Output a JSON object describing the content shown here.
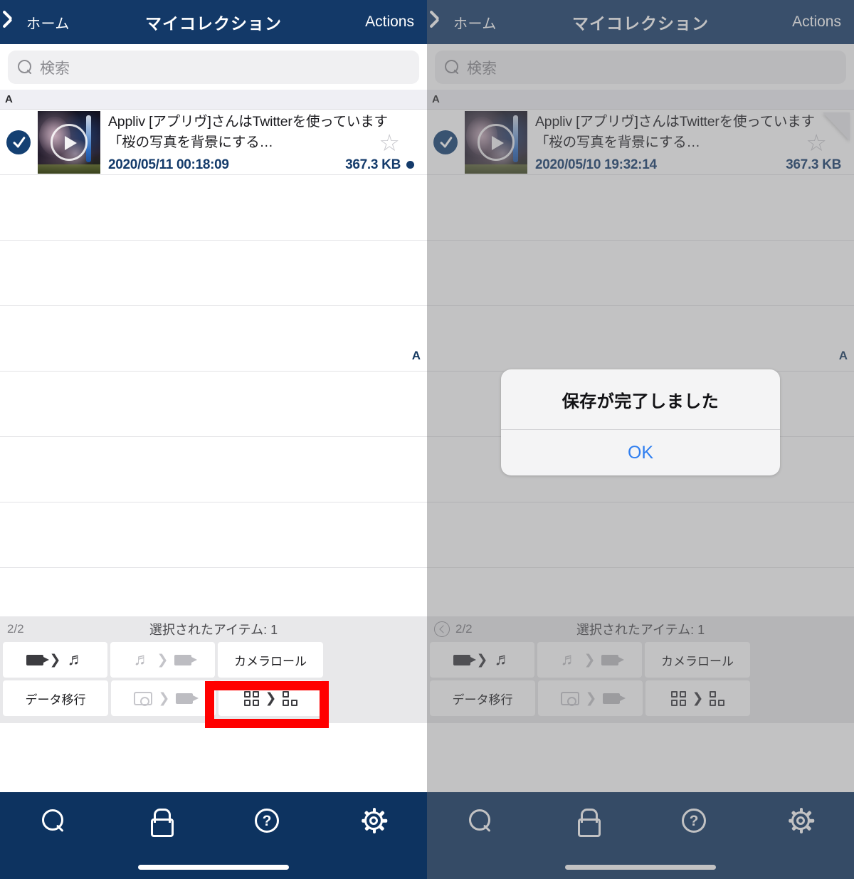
{
  "colors": {
    "navy": "#133968",
    "tabbar_navy": "#0d3360",
    "accent_blue": "#2f7ef0",
    "highlight_red": "#ff0000",
    "toolbar_gray": "#e8e8ea"
  },
  "nav": {
    "back_label": "ホーム",
    "title": "マイコレクション",
    "actions_label": "Actions"
  },
  "search": {
    "placeholder": "検索",
    "icon": "search-icon"
  },
  "section": {
    "header": "A",
    "index_letter": "A"
  },
  "left_panel": {
    "item": {
      "title": "Appliv [アプリヴ]さんはTwitterを使っています 「桜の写真を背景にする…",
      "date": "2020/05/11 00:18:09",
      "size": "367.3 KB",
      "selected": true,
      "starred": false,
      "star_icon": "star-outline-icon",
      "has_status_dot": true,
      "thumb_icon": "video-play-thumbnail"
    },
    "toolbar": {
      "page_counter": "2/2",
      "selected_count_label": "選択されたアイテム: 1",
      "show_back_circle": false,
      "buttons": [
        {
          "id": "video-to-audio",
          "label": "",
          "icons": [
            "video-icon",
            "chevron-right-icon",
            "music-note-icon"
          ],
          "disabled": false
        },
        {
          "id": "audio-to-video",
          "label": "",
          "icons": [
            "music-note-icon",
            "chevron-right-icon",
            "video-icon"
          ],
          "disabled": true
        },
        {
          "id": "camera-roll",
          "label": "カメラロール",
          "icons": [],
          "disabled": false,
          "highlighted": true
        },
        {
          "id": "data-transfer",
          "label": "データ移行",
          "icons": [],
          "disabled": false
        },
        {
          "id": "camera-folder-to-video",
          "label": "",
          "icons": [
            "camera-folder-icon",
            "chevron-right-icon",
            "video-icon"
          ],
          "disabled": true
        },
        {
          "id": "grid-to-list",
          "label": "",
          "icons": [
            "grid-4-icon",
            "chevron-right-icon",
            "grid-3-icon"
          ],
          "disabled": false
        }
      ]
    },
    "dimmed": false,
    "dialog": null
  },
  "right_panel": {
    "item": {
      "title": "Appliv [アプリヴ]さんはTwitterを使っています 「桜の写真を背景にする…",
      "date": "2020/05/10 19:32:14",
      "size": "367.3 KB",
      "selected": true,
      "starred": false,
      "star_icon": "star-outline-icon",
      "has_status_dot": false,
      "thumb_icon": "video-play-thumbnail"
    },
    "toolbar": {
      "page_counter": "2/2",
      "selected_count_label": "選択されたアイテム: 1",
      "show_back_circle": true,
      "buttons": [
        {
          "id": "video-to-audio",
          "label": "",
          "icons": [
            "video-icon",
            "chevron-right-icon",
            "music-note-icon"
          ],
          "disabled": false
        },
        {
          "id": "audio-to-video",
          "label": "",
          "icons": [
            "music-note-icon",
            "chevron-right-icon",
            "video-icon"
          ],
          "disabled": true
        },
        {
          "id": "camera-roll",
          "label": "カメラロール",
          "icons": [],
          "disabled": false,
          "highlighted": false
        },
        {
          "id": "data-transfer",
          "label": "データ移行",
          "icons": [],
          "disabled": false
        },
        {
          "id": "camera-folder-to-video",
          "label": "",
          "icons": [
            "camera-folder-icon",
            "chevron-right-icon",
            "video-icon"
          ],
          "disabled": true
        },
        {
          "id": "grid-to-list",
          "label": "",
          "icons": [
            "grid-4-icon",
            "chevron-right-icon",
            "grid-3-icon"
          ],
          "disabled": false
        }
      ]
    },
    "dimmed": true,
    "dialog": {
      "message": "保存が完了しました",
      "ok_label": "OK"
    }
  },
  "tabbar": {
    "items": [
      {
        "id": "search",
        "icon": "search-icon"
      },
      {
        "id": "lock",
        "icon": "lock-icon"
      },
      {
        "id": "help",
        "icon": "question-circle-icon",
        "glyph": "?"
      },
      {
        "id": "settings",
        "icon": "gear-icon"
      }
    ]
  },
  "list_rows": {
    "empty_row_count": 7
  }
}
